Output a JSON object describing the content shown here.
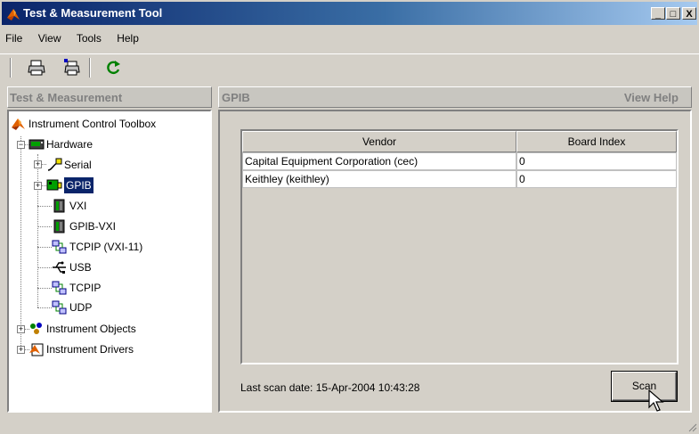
{
  "window": {
    "title": "Test & Measurement Tool",
    "controls": [
      "_",
      "□",
      "X"
    ]
  },
  "menu": [
    "File",
    "View",
    "Tools",
    "Help"
  ],
  "toolbar": {
    "icons": [
      "print-icon",
      "print-setup-icon",
      "refresh-icon"
    ]
  },
  "left_pane": {
    "header": "Test & Measurement",
    "tree": {
      "root": "Instrument Control Toolbox",
      "hardware": "Hardware",
      "serial": "Serial",
      "gpib": "GPIB",
      "vxi": "VXI",
      "gpib_vxi": "GPIB-VXI",
      "tcpip_vxi11": "TCPIP (VXI-11)",
      "usb": "USB",
      "tcpip": "TCPIP",
      "udp": "UDP",
      "instrument_objects": "Instrument Objects",
      "instrument_drivers": "Instrument Drivers"
    }
  },
  "right_pane": {
    "title": "GPIB",
    "help_link": "View Help",
    "table": {
      "headers": [
        "Vendor",
        "Board Index"
      ],
      "rows": [
        [
          "Capital Equipment Corporation (cec)",
          "0"
        ],
        [
          "Keithley (keithley)",
          "0"
        ]
      ]
    },
    "scan_date": "Last scan date: 15-Apr-2004 10:43:28",
    "scan_button": "Scan"
  },
  "colors": {
    "title_bar_start": "#0a246a",
    "title_bar_end": "#a6caf0",
    "selection": "#0a246a",
    "panel_gray": "#d4d0c8"
  }
}
